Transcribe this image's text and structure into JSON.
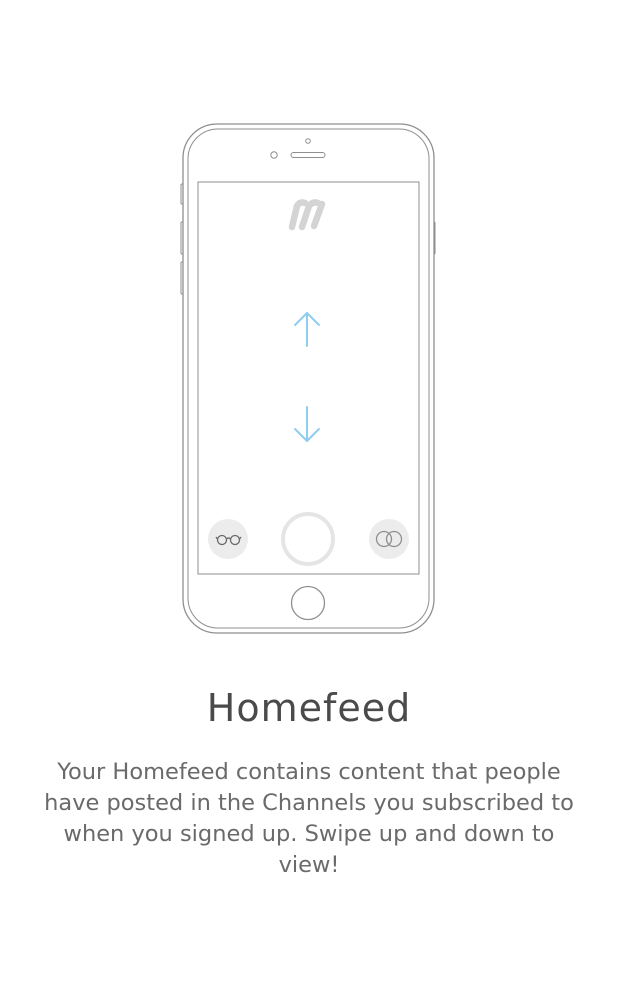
{
  "onboarding": {
    "title": "Homefeed",
    "description": "Your Homefeed contains content that people have posted in the Channels you subscribed to when you signed up. Swipe up and down to view!"
  },
  "icons": {
    "logo": "brand-logo-icon",
    "swipe_up": "arrow-up-icon",
    "swipe_down": "arrow-down-icon",
    "left_button": "glasses-icon",
    "center_button": "capture-button-icon",
    "right_button": "overlapping-circles-icon",
    "home_button": "home-button-icon"
  },
  "colors": {
    "arrow": "#8fcdef",
    "outline": "#8f8f8f",
    "logo": "#d4d4d4",
    "title": "#4a4a4a",
    "text": "#6a6a6a"
  }
}
